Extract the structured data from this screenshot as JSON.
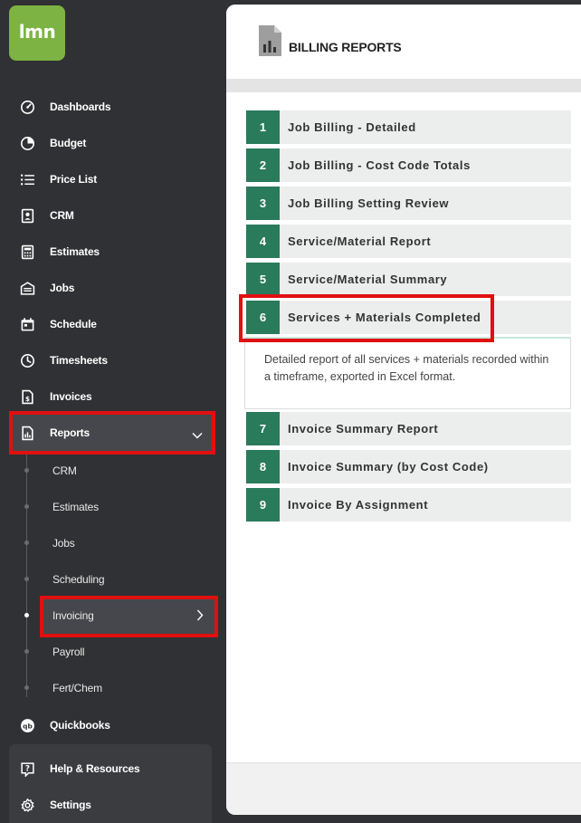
{
  "app": {
    "logo_text": "lmn",
    "brand_color": "#7cb342",
    "accent_color": "#2a7a5c",
    "highlight_color": "#e01010"
  },
  "sidebar": {
    "items": [
      {
        "label": "Dashboards",
        "icon": "dashboard-gauge-icon"
      },
      {
        "label": "Budget",
        "icon": "pie-chart-icon"
      },
      {
        "label": "Price List",
        "icon": "list-icon"
      },
      {
        "label": "CRM",
        "icon": "contact-card-icon"
      },
      {
        "label": "Estimates",
        "icon": "calculator-icon"
      },
      {
        "label": "Jobs",
        "icon": "jobs-garage-icon"
      },
      {
        "label": "Schedule",
        "icon": "calendar-icon"
      },
      {
        "label": "Timesheets",
        "icon": "clock-icon"
      },
      {
        "label": "Invoices",
        "icon": "invoice-document-icon"
      },
      {
        "label": "Reports",
        "icon": "report-document-icon"
      }
    ],
    "reports_sub": [
      "CRM",
      "Estimates",
      "Jobs",
      "Scheduling",
      "Invoicing",
      "Payroll",
      "Fert/Chem"
    ],
    "quickbooks": {
      "label": "Quickbooks",
      "icon": "quickbooks-icon"
    },
    "help": {
      "label": "Help & Resources",
      "icon": "help-icon"
    },
    "settings": {
      "label": "Settings",
      "icon": "gear-icon"
    }
  },
  "main": {
    "title": "BILLING REPORTS",
    "reports": [
      {
        "num": "1",
        "label": "Job Billing - Detailed"
      },
      {
        "num": "2",
        "label": "Job Billing - Cost Code Totals"
      },
      {
        "num": "3",
        "label": "Job Billing Setting Review"
      },
      {
        "num": "4",
        "label": "Service/Material Report"
      },
      {
        "num": "5",
        "label": "Service/Material Summary"
      },
      {
        "num": "6",
        "label": "Services + Materials Completed"
      },
      {
        "num": "7",
        "label": "Invoice Summary Report"
      },
      {
        "num": "8",
        "label": "Invoice Summary (by Cost Code)"
      },
      {
        "num": "9",
        "label": "Invoice By Assignment"
      }
    ],
    "expanded_description": "Detailed report of all services + materials recorded within a timeframe, exported in Excel format."
  }
}
